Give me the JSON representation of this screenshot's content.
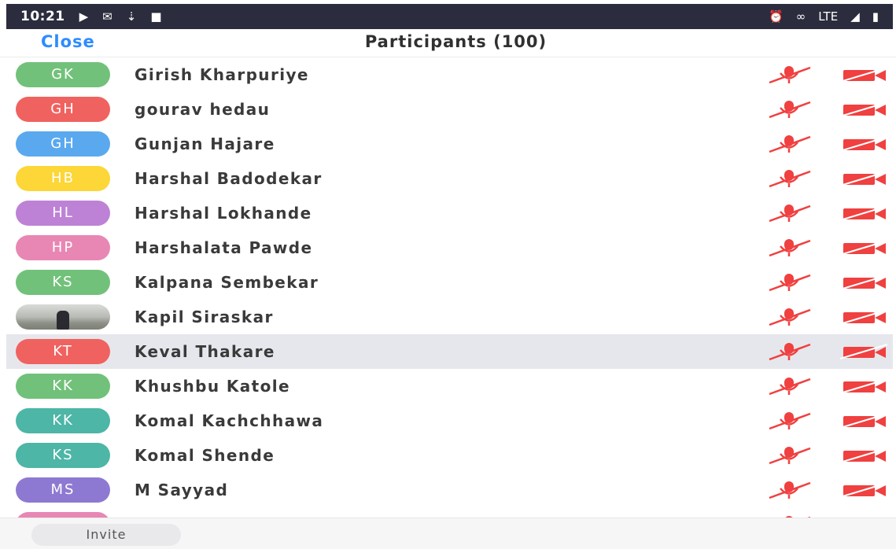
{
  "status_bar": {
    "time": "10:21",
    "left_icons": [
      "youtube-icon",
      "gmail-icon",
      "download-icon",
      "video-camera-icon"
    ],
    "right_icons": [
      "alarm-icon",
      "link-icon",
      "volte-icon",
      "signal-icon",
      "battery-icon"
    ],
    "network_label": "LTE"
  },
  "header": {
    "close_label": "Close",
    "title": "Participants (100)"
  },
  "participants": [
    {
      "initials": "GK",
      "name": "Girish Kharpuriye",
      "color": "#72c17a"
    },
    {
      "initials": "GH",
      "name": "gourav hedau",
      "color": "#f0625f"
    },
    {
      "initials": "GH",
      "name": "Gunjan Hajare",
      "color": "#5aa9ef"
    },
    {
      "initials": "HB",
      "name": "Harshal Badodekar",
      "color": "#fdd637"
    },
    {
      "initials": "HL",
      "name": "Harshal Lokhande",
      "color": "#bd82d6"
    },
    {
      "initials": "HP",
      "name": "Harshalata Pawde",
      "color": "#e887b4"
    },
    {
      "initials": "KS",
      "name": "Kalpana Sembekar",
      "color": "#72c17a"
    },
    {
      "initials": "",
      "name": "Kapil Siraskar",
      "color": "#b5b7b1",
      "photo": true
    },
    {
      "initials": "KT",
      "name": "Keval Thakare",
      "color": "#f0625f",
      "highlighted": true
    },
    {
      "initials": "KK",
      "name": "Khushbu Katole",
      "color": "#72c17a"
    },
    {
      "initials": "KK",
      "name": "Komal Kachchhawa",
      "color": "#4db6a6"
    },
    {
      "initials": "KS",
      "name": "Komal Shende",
      "color": "#4db6a6"
    },
    {
      "initials": "MS",
      "name": "M Sayyad",
      "color": "#8e79d2"
    },
    {
      "initials": "",
      "name": "",
      "color": "#e887b4"
    }
  ],
  "row_icons": {
    "mic": "muted-mic-icon",
    "video": "video-off-icon",
    "muted_color": "#f04040"
  },
  "bottom": {
    "invite_label": "Invite"
  }
}
